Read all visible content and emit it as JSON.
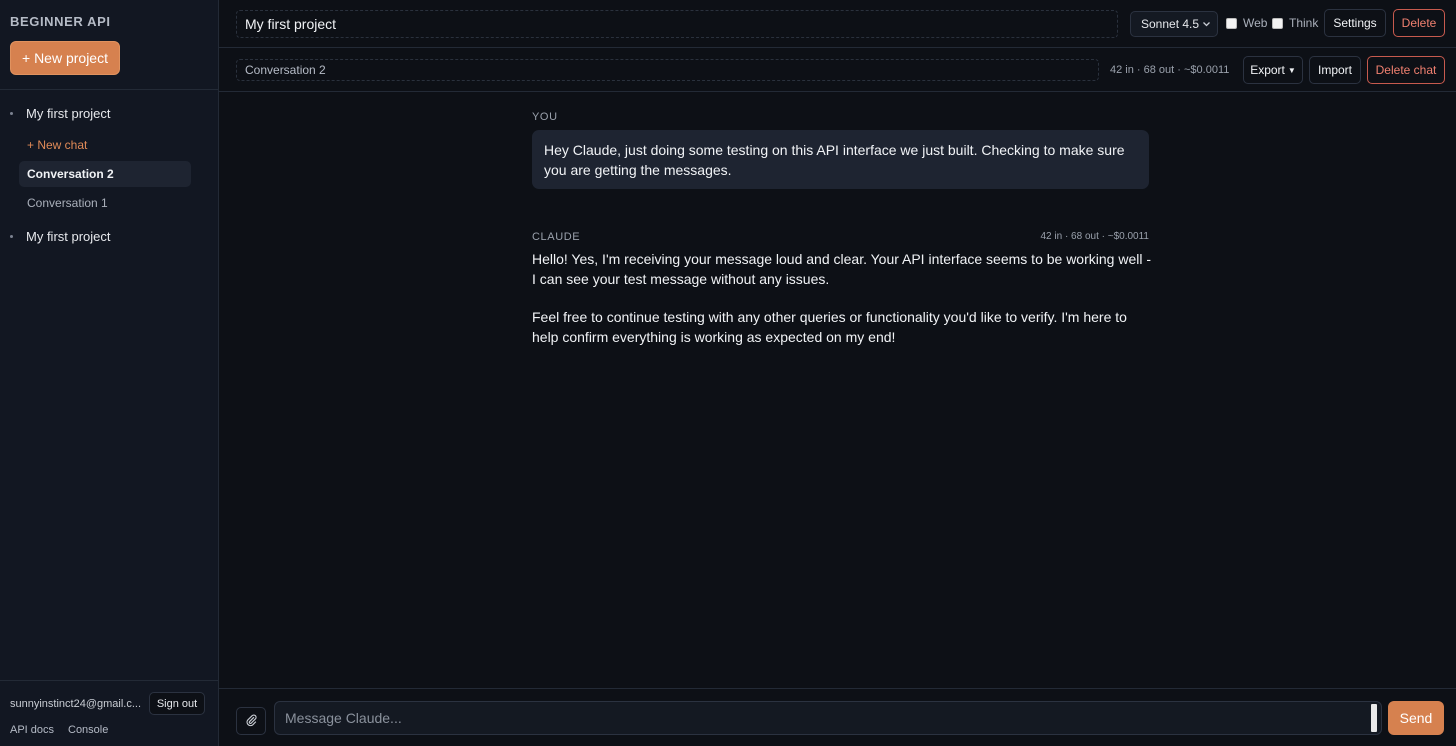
{
  "sidebar": {
    "brand": "BEGINNER API",
    "new_project_label": "+ New project",
    "projects": [
      {
        "name": "My first project"
      },
      {
        "name": "My first project"
      }
    ],
    "new_chat_label": "+ New chat",
    "conversations": [
      {
        "title": "Conversation 2",
        "active": true
      },
      {
        "title": "Conversation 1",
        "active": false
      }
    ],
    "user_email": "sunnyinstinct24@gmail.c...",
    "sign_out_label": "Sign out",
    "footer_links": [
      "API docs",
      "Console"
    ]
  },
  "topbar": {
    "project_title": "My first project",
    "model": "Sonnet 4.5",
    "web_label": "Web",
    "think_label": "Think",
    "settings_label": "Settings",
    "delete_label": "Delete"
  },
  "subbar": {
    "conversation_title": "Conversation 2",
    "usage": "42 in · 68 out · ~$0.0011",
    "export_label": "Export",
    "import_label": "Import",
    "delete_chat_label": "Delete chat"
  },
  "messages": [
    {
      "role_label": "YOU",
      "text": "Hey Claude, just doing some testing on this API interface we just built. Checking to make sure you are getting the messages."
    },
    {
      "role_label": "CLAUDE",
      "meta": "42 in · 68 out · ~$0.0011",
      "paragraphs": [
        "Hello! Yes, I'm receiving your message loud and clear. Your API interface seems to be working well - I can see your test message without any issues.",
        "Feel free to continue testing with any other queries or functionality you'd like to verify. I'm here to help confirm everything is working as expected on my end!"
      ]
    }
  ],
  "composer": {
    "placeholder": "Message Claude...",
    "send_label": "Send",
    "attach_icon": "paperclip-icon"
  },
  "colors": {
    "accent": "#d6814f",
    "danger": "#f08070",
    "background": "#0d1016",
    "sidebar": "#121722"
  }
}
